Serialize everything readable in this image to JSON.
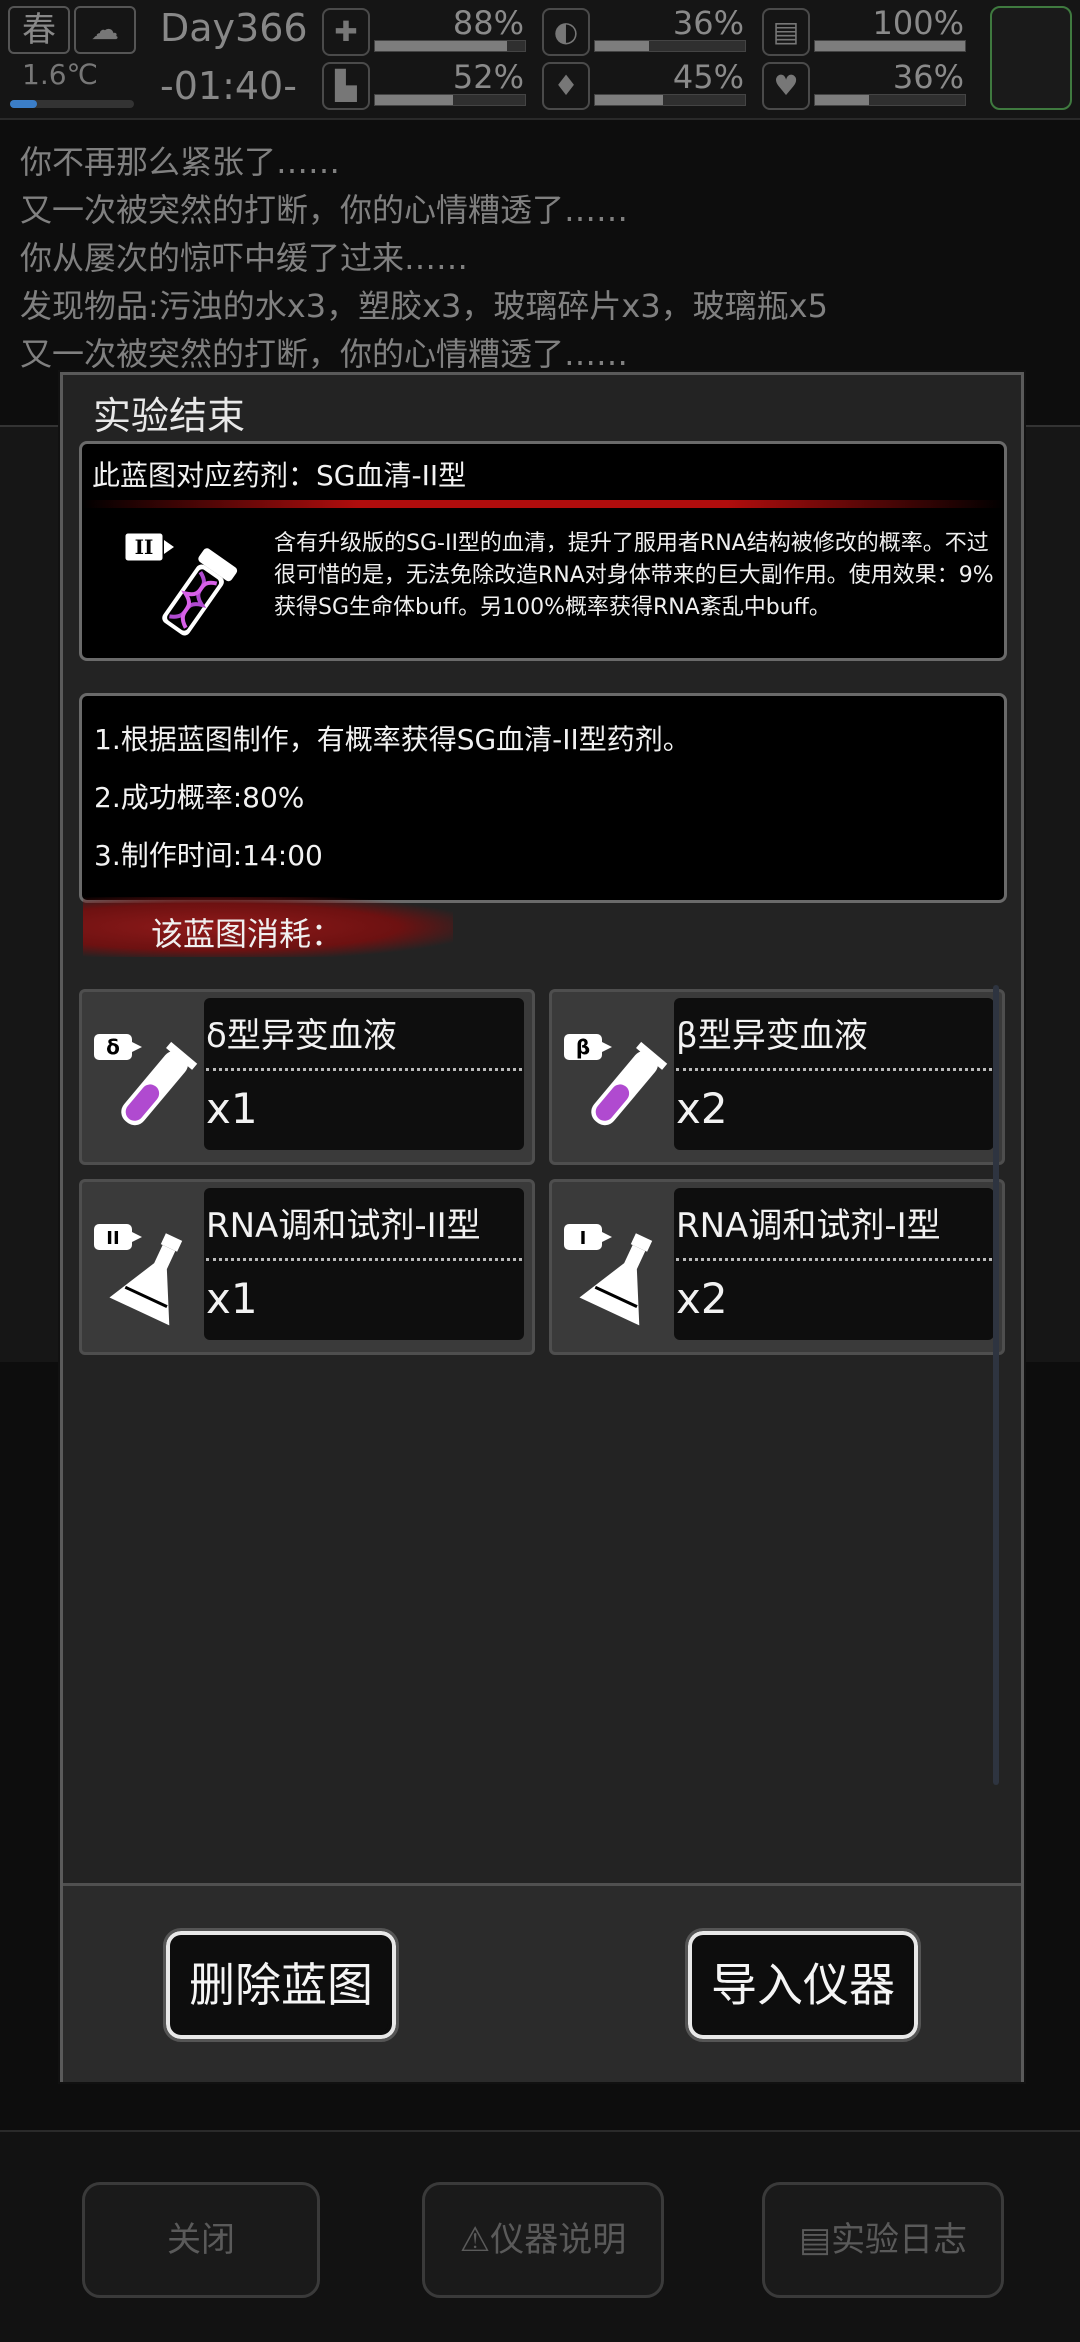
{
  "status": {
    "season": "春",
    "temperature": "1.6℃",
    "temperature_level": 0.22,
    "day": "Day366",
    "time": "-01:40-",
    "stats": [
      {
        "name": "health",
        "icon": "medkit-icon",
        "value": "88%",
        "level": 0.88
      },
      {
        "name": "hunger",
        "icon": "stomach-icon",
        "value": "36%",
        "level": 0.36
      },
      {
        "name": "energy",
        "icon": "battery-icon",
        "value": "100%",
        "level": 1.0
      },
      {
        "name": "stamina",
        "icon": "boot-icon",
        "value": "52%",
        "level": 0.52
      },
      {
        "name": "thirst",
        "icon": "water-drop-icon",
        "value": "45%",
        "level": 0.45
      },
      {
        "name": "mood",
        "icon": "heart-icon",
        "value": "36%",
        "level": 0.36
      }
    ]
  },
  "log": [
    "你不再那么紧张了……",
    "又一次被突然的打断，你的心情糟透了……",
    "你从屡次的惊吓中缓了过来……",
    "发现物品:污浊的水x3，塑胶x3，玻璃碎片x3，玻璃瓶x5",
    "又一次被突然的打断，你的心情糟透了……"
  ],
  "dialog": {
    "title": "实验结束",
    "blueprint": {
      "heading": "此蓝图对应药剂：SG血清-II型",
      "badge": "II",
      "description": "含有升级版的SG-II型的血清，提升了服用者RNA结构被修改的概率。不过很可惜的是，无法免除改造RNA对身体带来的巨大副作用。使用效果：9%获得SG生命体buff。另100%概率获得RNA紊乱中buff。"
    },
    "rules": [
      "1.根据蓝图制作，有概率获得SG血清-II型药剂。",
      "2.成功概率:80%",
      "3.制作时间:14:00"
    ],
    "consume_label": "该蓝图消耗：",
    "materials": [
      {
        "badge": "δ",
        "name": "δ型异变血液",
        "qty": "x1",
        "icon": "test-tube-icon"
      },
      {
        "badge": "β",
        "name": "β型异变血液",
        "qty": "x2",
        "icon": "test-tube-icon"
      },
      {
        "badge": "II",
        "name": "RNA调和试剂-II型",
        "qty": "x1",
        "icon": "flask-icon"
      },
      {
        "badge": "I",
        "name": "RNA调和试剂-I型",
        "qty": "x2",
        "icon": "flask-icon"
      }
    ],
    "delete_button": "删除蓝图",
    "import_button": "导入仪器"
  },
  "bottom_bar": {
    "close": "关闭",
    "instrument_info": "仪器说明",
    "lab_log": "实验日志"
  },
  "colors": {
    "accent_red": "#b00d0d",
    "serum_purple": "#b04ad0",
    "slot_green": "#3f7a3f"
  }
}
